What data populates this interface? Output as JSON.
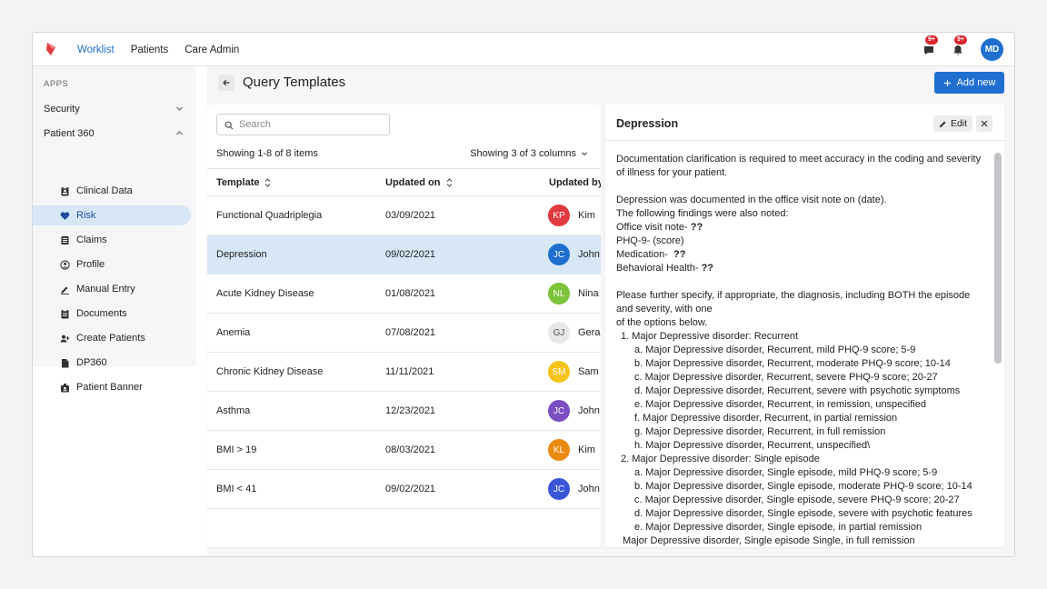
{
  "nav": {
    "items": [
      {
        "label": "Worklist",
        "active": true
      },
      {
        "label": "Patients",
        "active": false
      },
      {
        "label": "Care Admin",
        "active": false
      }
    ],
    "chat_badge": "9+",
    "bell_badge": "9+",
    "user_initials": "MD"
  },
  "colors": {
    "accent": "#1f6fd1",
    "selected_row": "#d8e7f6",
    "badge": "#d9252f"
  },
  "sidebar": {
    "section_label": "APPS",
    "groups": [
      {
        "label": "Security",
        "expanded": false
      },
      {
        "label": "Patient 360",
        "expanded": true
      }
    ],
    "items": [
      {
        "label": "Clinical Data",
        "icon": "clipboard-icon"
      },
      {
        "label": "Risk",
        "icon": "heart-icon",
        "active": true
      },
      {
        "label": "Claims",
        "icon": "list-icon"
      },
      {
        "label": "Profile",
        "icon": "user-circle-icon"
      },
      {
        "label": "Manual Entry",
        "icon": "pen-icon"
      },
      {
        "label": "Documents",
        "icon": "document-icon"
      },
      {
        "label": "Create Patients",
        "icon": "user-add-icon"
      },
      {
        "label": "DP360",
        "icon": "file-icon"
      },
      {
        "label": "Patient Banner",
        "icon": "badge-icon"
      }
    ]
  },
  "page": {
    "title": "Query Templates",
    "add_label": "Add new"
  },
  "list": {
    "search_placeholder": "Search",
    "showing_text": "Showing 1-8 of 8 items",
    "columns_text": "Showing 3 of 3 columns",
    "headers": [
      "Template",
      "Updated on",
      "Updated by"
    ],
    "rows": [
      {
        "template": "Functional Quadriplegia",
        "updated_on": "03/09/2021",
        "initials": "KP",
        "name": "Kim",
        "color": "#e0393e"
      },
      {
        "template": "Depression",
        "updated_on": "09/02/2021",
        "initials": "JC",
        "name": "John",
        "color": "#1f6fd1",
        "selected": true
      },
      {
        "template": "Acute Kidney Disease",
        "updated_on": "01/08/2021",
        "initials": "NL",
        "name": "Nina",
        "color": "#7cc43a"
      },
      {
        "template": "Anemia",
        "updated_on": "07/08/2021",
        "initials": "GJ",
        "name": "Gerar",
        "color": "#e7e7ea",
        "dark_text": true
      },
      {
        "template": "Chronic Kidney Disease",
        "updated_on": "11/11/2021",
        "initials": "SM",
        "name": "Sam",
        "color": "#f6c31a"
      },
      {
        "template": "Asthma",
        "updated_on": "12/23/2021",
        "initials": "JC",
        "name": "John",
        "color": "#7b4fc1"
      },
      {
        "template": "BMI > 19",
        "updated_on": "08/03/2021",
        "initials": "KL",
        "name": "Kim",
        "color": "#ea8a12"
      },
      {
        "template": "BMI < 41",
        "updated_on": "09/02/2021",
        "initials": "JC",
        "name": "John",
        "color": "#3b55d9"
      }
    ]
  },
  "detail": {
    "title": "Depression",
    "edit_label": "Edit",
    "intro": "Documentation clarification is required to meet accuracy in the coding and severity of illness for your patient.",
    "documented": "Depression was documented in the office visit note on (date).",
    "findings_intro": "The following findings were also noted:",
    "findings": [
      {
        "label": "Office visit note- ",
        "value": "??"
      },
      {
        "label": "PHQ-9- (score)",
        "value": ""
      },
      {
        "label": "Medication-  ",
        "value": "??"
      },
      {
        "label": "Behavioral Health- ",
        "value": "??"
      }
    ],
    "specify": "Please further specify, if appropriate, the diagnosis, including BOTH the episode and severity, with one",
    "options_intro": "of the options below.",
    "sections": [
      {
        "heading": "1.  Major Depressive disorder: Recurrent",
        "items": [
          "a.  Major Depressive disorder, Recurrent, mild PHQ-9 score; 5-9",
          "b.  Major Depressive disorder, Recurrent, moderate PHQ-9 score; 10-14",
          "c.  Major Depressive disorder, Recurrent, severe PHQ-9 score; 20-27",
          "d.  Major Depressive disorder, Recurrent, severe with psychotic symptoms",
          "e.  Major Depressive disorder, Recurrent, in remission, unspecified",
          "f.  Major Depressive disorder, Recurrent, in partial remission",
          "g.  Major Depressive disorder, Recurrent, in full remission",
          "h.  Major Depressive disorder, Recurrent, unspecified\\"
        ]
      },
      {
        "heading": "2.  Major Depressive disorder: Single episode",
        "items": [
          "a.  Major Depressive disorder, Single episode, mild PHQ-9 score; 5-9",
          "b.  Major Depressive disorder, Single episode, moderate PHQ-9 score; 10-14",
          "c.  Major Depressive disorder, Single episode, severe PHQ-9 score; 20-27",
          "d.  Major Depressive disorder, Single episode, severe with psychotic features",
          "e.  Major Depressive disorder, Single episode, in partial remission"
        ]
      }
    ],
    "tail": "Major Depressive disorder, Single episode Single, in full remission"
  }
}
